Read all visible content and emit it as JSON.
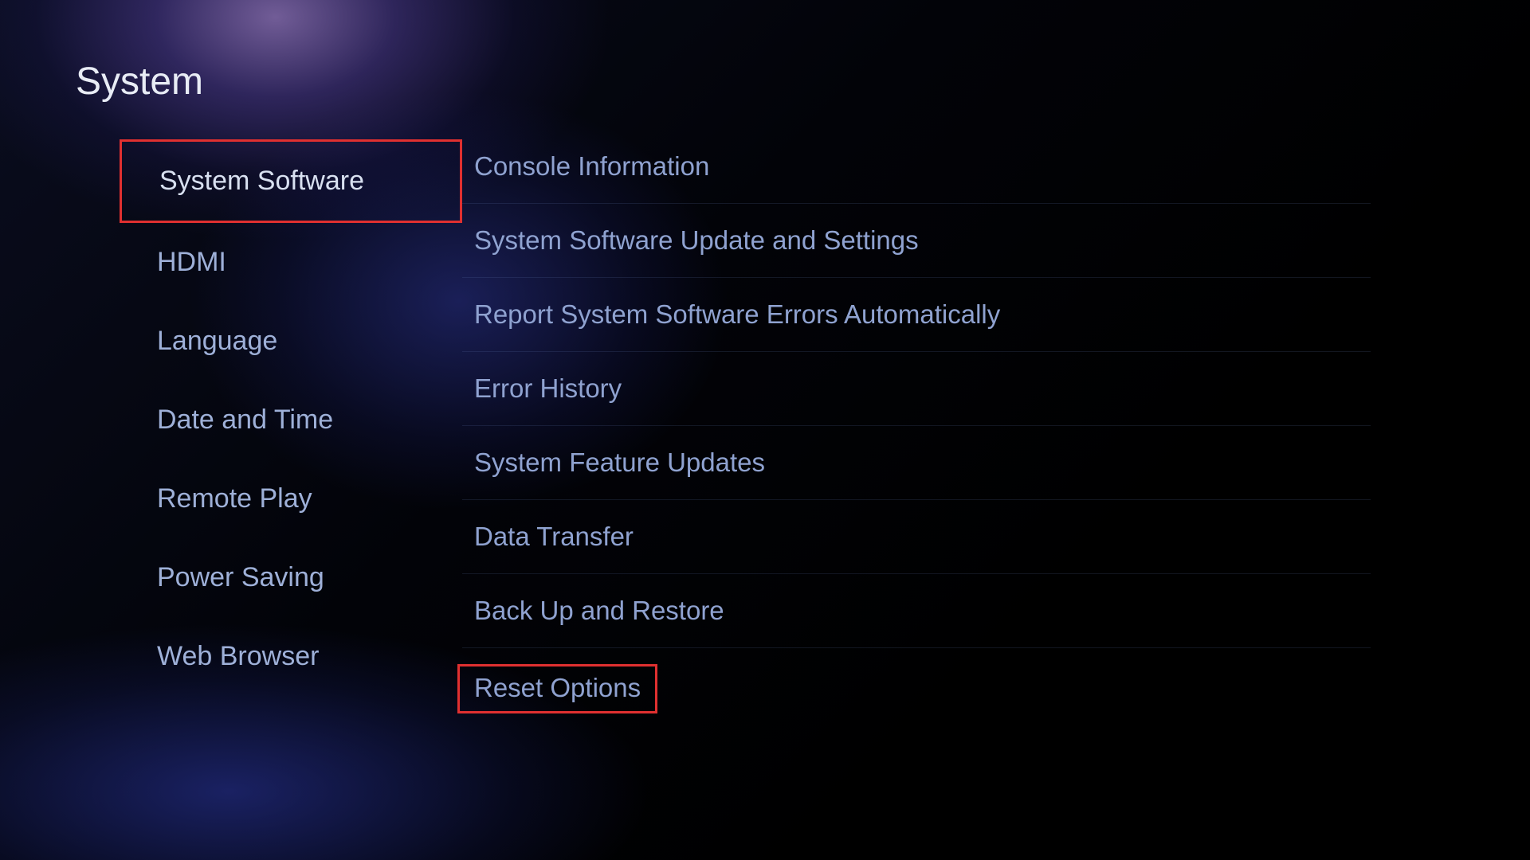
{
  "title": "System",
  "sidebar": {
    "items": [
      {
        "label": "System Software",
        "highlighted": true
      },
      {
        "label": "HDMI",
        "highlighted": false
      },
      {
        "label": "Language",
        "highlighted": false
      },
      {
        "label": "Date and Time",
        "highlighted": false
      },
      {
        "label": "Remote Play",
        "highlighted": false
      },
      {
        "label": "Power Saving",
        "highlighted": false
      },
      {
        "label": "Web Browser",
        "highlighted": false
      }
    ]
  },
  "main": {
    "items": [
      {
        "label": "Console Information",
        "highlighted": false
      },
      {
        "label": "System Software Update and Settings",
        "highlighted": false
      },
      {
        "label": "Report System Software Errors Automatically",
        "highlighted": false
      },
      {
        "label": "Error History",
        "highlighted": false
      },
      {
        "label": "System Feature Updates",
        "highlighted": false
      },
      {
        "label": "Data Transfer",
        "highlighted": false
      },
      {
        "label": "Back Up and Restore",
        "highlighted": false
      },
      {
        "label": "Reset Options",
        "highlighted": true
      }
    ]
  },
  "colors": {
    "highlight": "#e03030",
    "text_primary": "#e8ecf5",
    "text_secondary": "#9eb0d8"
  }
}
